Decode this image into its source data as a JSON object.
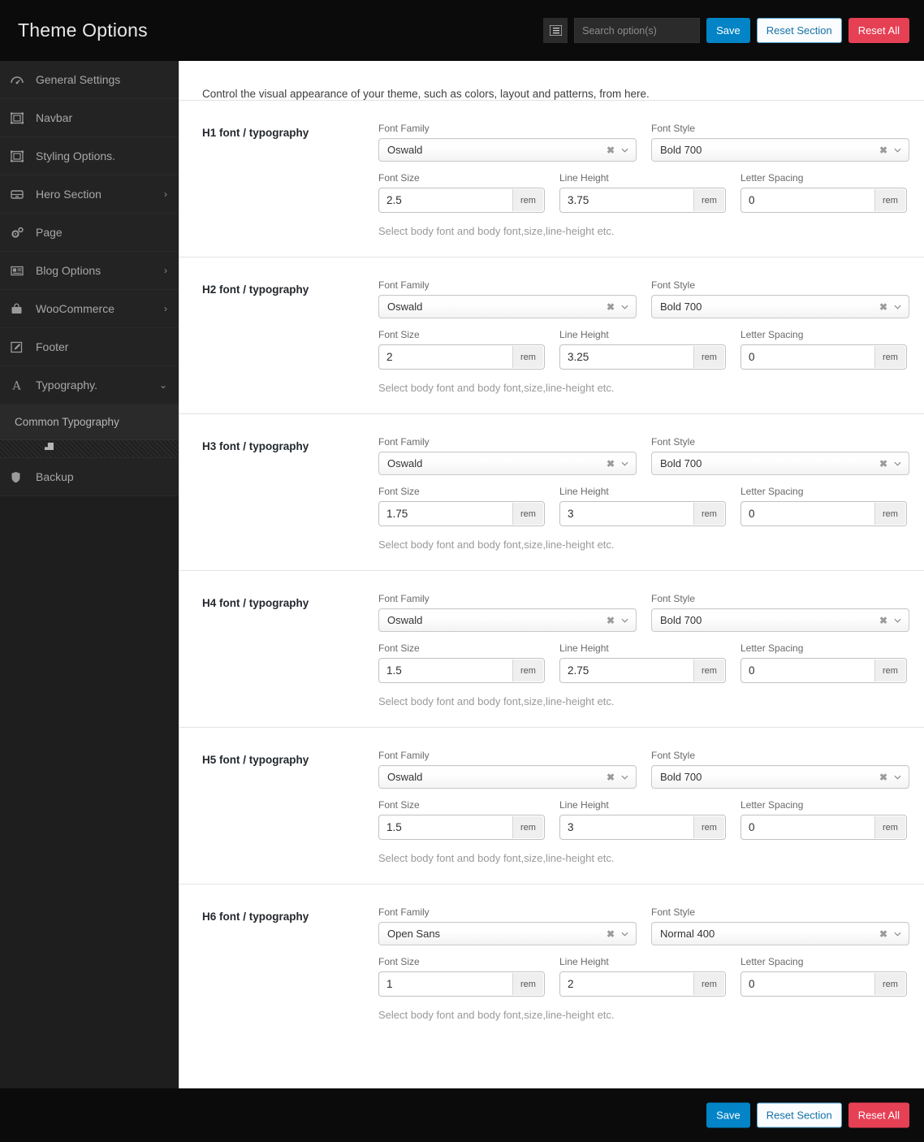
{
  "header": {
    "title": "Theme Options",
    "expand_icon": "list-toggle-icon",
    "search": {
      "placeholder": "Search option(s)",
      "value": ""
    },
    "save_label": "Save",
    "reset_section_label": "Reset Section",
    "reset_all_label": "Reset All",
    "bg_color": "#0b0b0b",
    "save_color": "#0284c7",
    "reset_all_color": "#e64055",
    "reset_section_color": "#4e9fd0"
  },
  "sidebar": {
    "items": [
      {
        "label": "General Settings",
        "icon": "dashboard-icon",
        "chevron": ""
      },
      {
        "label": "Navbar",
        "icon": "layout-frame-icon",
        "chevron": ""
      },
      {
        "label": "Styling Options.",
        "icon": "layout-frame-icon",
        "chevron": ""
      },
      {
        "label": "Hero Section",
        "icon": "drawer-icon",
        "chevron": "›"
      },
      {
        "label": "Page",
        "icon": "gears-icon",
        "chevron": ""
      },
      {
        "label": "Blog Options",
        "icon": "newspaper-icon",
        "chevron": "›"
      },
      {
        "label": "WooCommerce",
        "icon": "shopping-bag-icon",
        "chevron": "›"
      },
      {
        "label": "Footer",
        "icon": "pencil-square-icon",
        "chevron": ""
      },
      {
        "label": "Typography.",
        "icon": "font-letter-a-icon",
        "chevron": "⌄"
      }
    ],
    "sub_item": {
      "label": "Common Typography"
    },
    "backup": {
      "label": "Backup",
      "icon": "shield-icon"
    }
  },
  "main": {
    "intro": "Control the visual appearance of your theme, such as colors, layout and patterns, from here.",
    "labels": {
      "font_family": "Font Family",
      "font_style": "Font Style",
      "font_size": "Font Size",
      "line_height": "Line Height",
      "letter_spacing": "Letter Spacing",
      "unit": "rem"
    },
    "helper_text": "Select body font and body font,size,line-height etc.",
    "sections": [
      {
        "title": "H1 font / typography",
        "font_family": "Oswald",
        "font_style": "Bold 700",
        "font_size": "2.5",
        "line_height": "3.75",
        "letter_spacing": "0"
      },
      {
        "title": "H2 font / typography",
        "font_family": "Oswald",
        "font_style": "Bold 700",
        "font_size": "2",
        "line_height": "3.25",
        "letter_spacing": "0"
      },
      {
        "title": "H3 font / typography",
        "font_family": "Oswald",
        "font_style": "Bold 700",
        "font_size": "1.75",
        "line_height": "3",
        "letter_spacing": "0"
      },
      {
        "title": "H4 font / typography",
        "font_family": "Oswald",
        "font_style": "Bold 700",
        "font_size": "1.5",
        "line_height": "2.75",
        "letter_spacing": "0"
      },
      {
        "title": "H5 font / typography",
        "font_family": "Oswald",
        "font_style": "Bold 700",
        "font_size": "1.5",
        "line_height": "3",
        "letter_spacing": "0"
      },
      {
        "title": "H6 font / typography",
        "font_family": "Open Sans",
        "font_style": "Normal 400",
        "font_size": "1",
        "line_height": "2",
        "letter_spacing": "0"
      }
    ]
  },
  "footer": {
    "save_label": "Save",
    "reset_section_label": "Reset Section",
    "reset_all_label": "Reset All"
  }
}
